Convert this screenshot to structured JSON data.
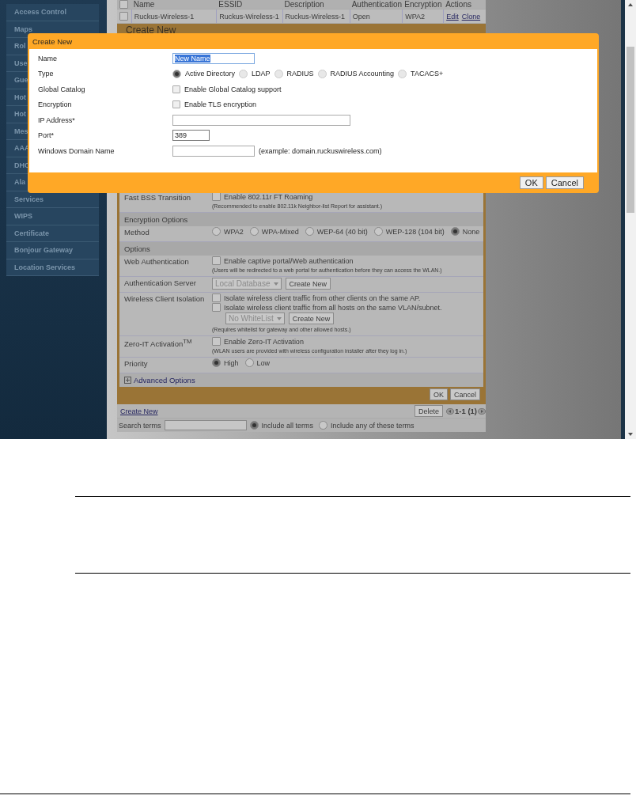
{
  "sidebar": {
    "items": [
      "Access Control",
      "Maps",
      "Rol",
      "Use",
      "Gue",
      "Hot",
      "Hot",
      "Mes",
      "AAA",
      "DHC",
      "Ala",
      "Services",
      "WIPS",
      "Certificate",
      "Bonjour Gateway",
      "Location Services"
    ]
  },
  "wlan_table": {
    "header_checked": false,
    "columns": [
      "Name",
      "ESSID",
      "Description",
      "Authentication",
      "Encryption",
      "Actions"
    ],
    "rows": [
      {
        "checked": false,
        "cells": [
          "Ruckus-Wireless-1",
          "Ruckus-Wireless-1",
          "Ruckus-Wireless-1",
          "Open",
          "WPA2"
        ],
        "actions": [
          "Edit",
          "Clone"
        ]
      }
    ]
  },
  "wlan_form": {
    "title": "Create New",
    "rows": [
      {
        "kind": "field",
        "label": "Fast BSS Transition",
        "lines": [
          [
            {
              "kind": "checkbox",
              "text": "Enable 802.11r FT Roaming",
              "checked": false
            }
          ],
          [
            {
              "kind": "note",
              "text": "(Recommended to enable 802.11k Neighbor-list Report for assistant.)"
            }
          ]
        ]
      },
      {
        "kind": "section",
        "label": "Encryption Options"
      },
      {
        "kind": "field",
        "label": "Method",
        "lines": [
          [
            {
              "kind": "radio",
              "text": "WPA2",
              "selected": false
            },
            {
              "kind": "radio",
              "text": "WPA-Mixed",
              "selected": false
            },
            {
              "kind": "radio",
              "text": "WEP-64 (40 bit)",
              "selected": false
            },
            {
              "kind": "radio",
              "text": "WEP-128 (104 bit)",
              "selected": false
            },
            {
              "kind": "radio",
              "text": "None",
              "selected": true
            }
          ]
        ]
      },
      {
        "kind": "section",
        "label": "Options"
      },
      {
        "kind": "field",
        "label": "Web Authentication",
        "lines": [
          [
            {
              "kind": "checkbox",
              "text": "Enable captive portal/Web authentication",
              "checked": false
            }
          ],
          [
            {
              "kind": "note",
              "text": "(Users will be redirected to a web portal for authentication before they can access the WLAN.)"
            }
          ]
        ]
      },
      {
        "kind": "field",
        "label": "Authentication Server",
        "lines": [
          [
            {
              "kind": "select",
              "text": "Local Database"
            },
            {
              "kind": "button",
              "text": "Create New"
            }
          ]
        ]
      },
      {
        "kind": "field",
        "label": "Wireless Client Isolation",
        "lines": [
          [
            {
              "kind": "checkbox",
              "text": "Isolate wireless client traffic from other clients on the same AP.",
              "checked": false
            }
          ],
          [
            {
              "kind": "checkbox",
              "text": "Isolate wireless client traffic from all hosts on the same VLAN/subnet.",
              "checked": false
            }
          ],
          [
            {
              "kind": "indent"
            },
            {
              "kind": "select",
              "text": "No WhiteList"
            },
            {
              "kind": "button",
              "text": "Create New"
            }
          ],
          [
            {
              "kind": "note",
              "text": "(Requires whitelist for gateway and other allowed hosts.)"
            }
          ]
        ]
      },
      {
        "kind": "field",
        "label": "Zero-IT Activation$^{TM}$",
        "lines": [
          [
            {
              "kind": "checkbox",
              "text": "Enable Zero-IT Activation",
              "checked": false
            }
          ],
          [
            {
              "kind": "note",
              "text": "(WLAN users are provided with wireless configuration installer after they log in.)"
            }
          ]
        ]
      },
      {
        "kind": "field",
        "label": "Priority",
        "lines": [
          [
            {
              "kind": "radio",
              "text": "High",
              "selected": true
            },
            {
              "kind": "radio",
              "text": "Low",
              "selected": false
            }
          ]
        ]
      },
      {
        "kind": "expander",
        "label": "Advanced Options",
        "expanded": false
      }
    ],
    "buttons": [
      "OK",
      "Cancel"
    ]
  },
  "list_footer": {
    "link": "Create New",
    "delete": "Delete",
    "range": "1-1 (1)"
  },
  "search": {
    "label": "Search terms",
    "options": [
      {
        "text": "Include all terms",
        "selected": true
      },
      {
        "text": "Include any of these terms",
        "selected": false
      }
    ]
  },
  "dialog": {
    "title": "Create New",
    "rows": [
      {
        "label": "Name",
        "lines": [
          [
            {
              "kind": "input",
              "value": "New Name",
              "text_selected": true
            }
          ]
        ]
      },
      {
        "label": "Type",
        "lines": [
          [
            {
              "kind": "radio",
              "text": "Active Directory",
              "selected": true
            },
            {
              "kind": "radio",
              "text": "LDAP",
              "selected": false
            },
            {
              "kind": "radio",
              "text": "RADIUS",
              "selected": false
            },
            {
              "kind": "radio",
              "text": "RADIUS Accounting",
              "selected": false
            },
            {
              "kind": "radio",
              "text": "TACACS+",
              "selected": false
            }
          ]
        ]
      },
      {
        "label": "Global Catalog",
        "lines": [
          [
            {
              "kind": "checkbox",
              "text": "Enable Global Catalog support",
              "checked": false
            }
          ]
        ]
      },
      {
        "label": "Encryption",
        "lines": [
          [
            {
              "kind": "checkbox",
              "text": "Enable TLS encryption",
              "checked": false
            }
          ]
        ]
      },
      {
        "label": "IP Address*",
        "lines": [
          [
            {
              "kind": "input"
            }
          ]
        ]
      },
      {
        "label": "Port*",
        "lines": [
          [
            {
              "kind": "input",
              "value": "389",
              "text_selected": false
            }
          ]
        ]
      },
      {
        "label": "Windows Domain Name",
        "lines": [
          [
            {
              "kind": "input"
            },
            {
              "kind": "text",
              "text": "(example: domain.ruckuswireless.com)"
            }
          ]
        ]
      }
    ],
    "buttons": [
      "OK",
      "Cancel"
    ]
  }
}
